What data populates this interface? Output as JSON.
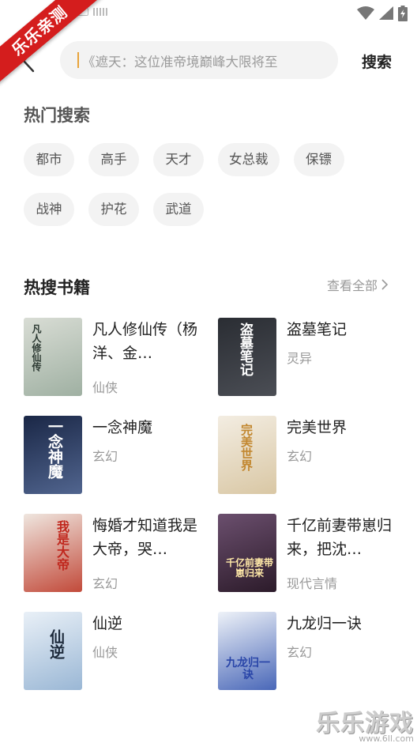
{
  "status": {
    "signal_icon": "wifi-icon",
    "cell_icon": "cell-signal-icon",
    "battery_icon": "battery-icon"
  },
  "ribbon": {
    "label": "乐乐亲测"
  },
  "search": {
    "placeholder": "《遮天：这位准帝境巅峰大限将至",
    "action_label": "搜索"
  },
  "hot_search": {
    "title": "热门搜索",
    "tags": [
      "都市",
      "高手",
      "天才",
      "女总裁",
      "保镖",
      "战神",
      "护花",
      "武道"
    ]
  },
  "hot_books": {
    "title": "热搜书籍",
    "view_all": "查看全部",
    "books": [
      {
        "title": "凡人修仙传（杨洋、金…",
        "genre": "仙侠",
        "cover_text": "凡人修仙传",
        "cover_colors": [
          "#d9ddd5",
          "#9fb0a2"
        ]
      },
      {
        "title": "盗墓笔记",
        "genre": "灵异",
        "cover_text": "盗墓笔记",
        "cover_colors": [
          "#2a2d33",
          "#4b4e55"
        ]
      },
      {
        "title": "一念神魔",
        "genre": "玄幻",
        "cover_text": "一念神魔",
        "cover_colors": [
          "#1a2746",
          "#51658f"
        ]
      },
      {
        "title": "完美世界",
        "genre": "玄幻",
        "cover_text": "完美世界",
        "cover_colors": [
          "#f3ede2",
          "#d9c7a4"
        ]
      },
      {
        "title": "悔婚才知道我是大帝，哭…",
        "genre": "玄幻",
        "cover_text": "我是大帝",
        "cover_colors": [
          "#efe6df",
          "#c24a3a"
        ]
      },
      {
        "title": "千亿前妻带崽归来，把沈…",
        "genre": "现代言情",
        "cover_text": "千亿前妻带崽归来",
        "cover_colors": [
          "#6b4f6e",
          "#2c1b2a"
        ]
      },
      {
        "title": "仙逆",
        "genre": "仙侠",
        "cover_text": "仙逆",
        "cover_colors": [
          "#e9f0f7",
          "#9ab7d5"
        ]
      },
      {
        "title": "九龙归一诀",
        "genre": "玄幻",
        "cover_text": "九龙归一诀",
        "cover_colors": [
          "#eef2f8",
          "#4967b8"
        ]
      }
    ]
  },
  "watermark": {
    "main": "乐乐游戏",
    "sub": "www.6ll.com"
  }
}
